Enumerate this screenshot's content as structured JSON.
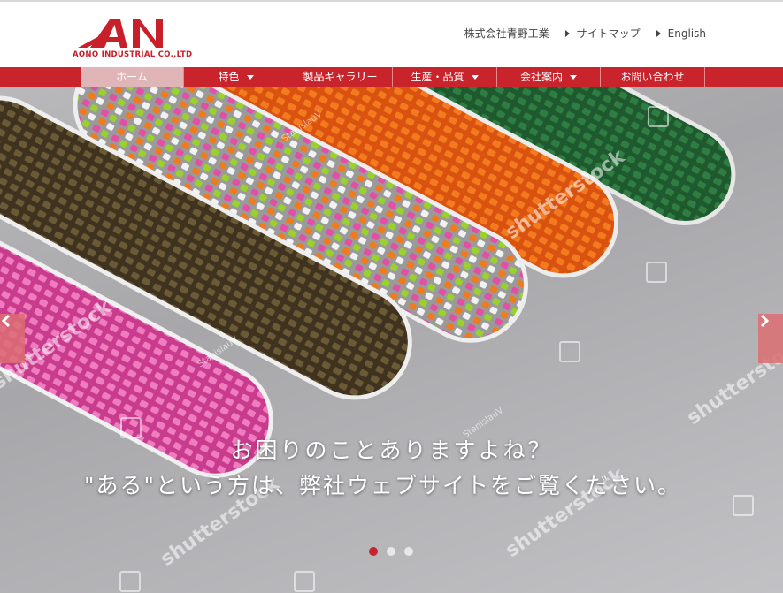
{
  "header": {
    "logo_mark": "AN",
    "logo_text": "AONO INDUSTRIAL CO.,LTD",
    "links": [
      {
        "label": "株式会社青野工業"
      },
      {
        "label": "サイトマップ"
      },
      {
        "label": "English"
      }
    ]
  },
  "nav": {
    "items": [
      {
        "label": "ホーム"
      },
      {
        "label": "特色"
      },
      {
        "label": "製品ギャラリー"
      },
      {
        "label": "生産・品質"
      },
      {
        "label": "会社案内"
      },
      {
        "label": "お問い合わせ"
      }
    ]
  },
  "hero": {
    "caption_line1": "お困りのことありますよね？",
    "caption_line2": "\"ある\"という方は、弊社ウェブサイトをご覧ください。",
    "watermark": "shutterstock",
    "watermark_author": "StanislauV",
    "slides_total": 3,
    "active_slide": 1
  },
  "colors": {
    "brand_red": "#c9232b",
    "nav_active": "#e0b5b7"
  }
}
